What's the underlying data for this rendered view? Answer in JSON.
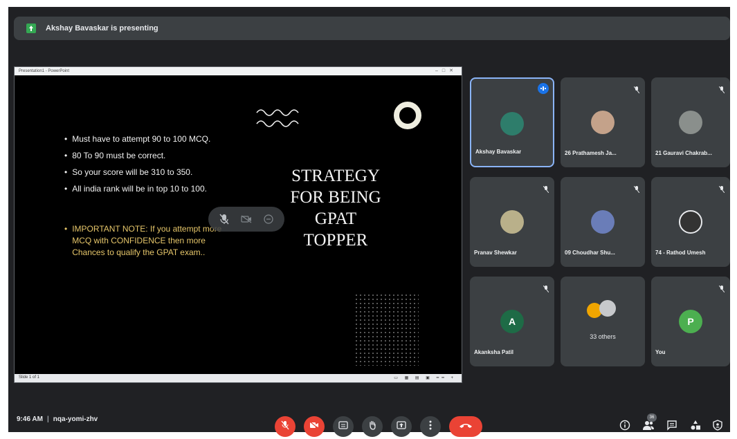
{
  "banner": {
    "text": "Akshay Bavaskar is presenting"
  },
  "shared_screen": {
    "window_title": "Presentation1 - PowerPoint",
    "status_left": "Slide 1 of 1",
    "slide": {
      "bullets": [
        "Must have to attempt 90 to 100 MCQ.",
        "80 To 90 must be correct.",
        "So your score will be 310 to 350.",
        "All india rank will be in top 10 to 100."
      ],
      "important_note": "IMPORTANT NOTE: If you attempt more MCQ with CONFIDENCE then more Chances to qualify the GPAT exam..",
      "title_lines": [
        "STRATEGY",
        "FOR BEING",
        "GPAT",
        "TOPPER"
      ],
      "squiggle_color": "#f2f2f2",
      "note_color": "#e6c66a",
      "ring_color": "#efeee0"
    }
  },
  "participants": [
    {
      "name": "Akshay Bavaskar",
      "speaking": true,
      "avatar_color": "#2e7d6b"
    },
    {
      "name": "26 Prathamesh Ja...",
      "speaking": false,
      "avatar_color": "#c4a28a"
    },
    {
      "name": "21 Gauravi Chakrab...",
      "speaking": false,
      "avatar_color": "#8a8f8c"
    },
    {
      "name": "Pranav Shewkar",
      "speaking": false,
      "avatar_color": "#b9b08a"
    },
    {
      "name": "09 Choudhar Shu...",
      "speaking": false,
      "avatar_color": "#6a7db8"
    },
    {
      "name": "74 - Rathod Umesh",
      "speaking": false,
      "avatar_color": "#333333"
    },
    {
      "name": "Akanksha Patil",
      "speaking": false,
      "avatar_letter": "A",
      "avatar_color": "#1e6b46"
    },
    {
      "name": "",
      "others_label": "33 others",
      "speaking": false
    },
    {
      "name": "You",
      "speaking": false,
      "avatar_letter": "P",
      "avatar_color": "#4caf50"
    }
  ],
  "bottom_bar": {
    "time": "9:46 AM",
    "meeting_code": "nqa-yomi-zhv",
    "participant_count": "36",
    "colors": {
      "danger": "#ea4335",
      "button": "#3c4043"
    }
  },
  "icons": {
    "mic_off": "mic-off-icon",
    "cam_off": "camera-off-icon",
    "captions": "captions-icon",
    "raise_hand": "raise-hand-icon",
    "present": "present-icon",
    "more": "more-options-icon",
    "end_call": "end-call-icon",
    "info": "info-icon",
    "people": "people-icon",
    "chat": "chat-icon",
    "activities": "activities-icon",
    "security": "host-controls-icon"
  }
}
